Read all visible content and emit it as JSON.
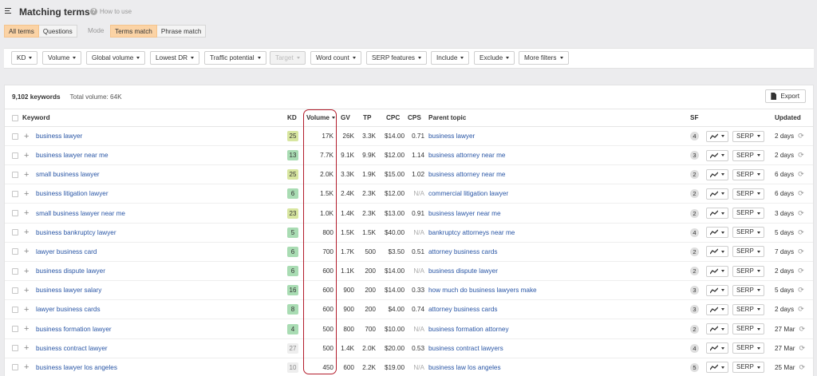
{
  "header": {
    "title": "Matching terms",
    "help_label": "How to use",
    "mode_label": "Mode",
    "scope_tabs": [
      {
        "label": "All terms",
        "active": true
      },
      {
        "label": "Questions",
        "active": false
      }
    ],
    "mode_tabs": [
      {
        "label": "Terms match",
        "active": true
      },
      {
        "label": "Phrase match",
        "active": false
      }
    ]
  },
  "filters": [
    {
      "label": "KD",
      "disabled": false
    },
    {
      "label": "Volume",
      "disabled": false
    },
    {
      "label": "Global volume",
      "disabled": false
    },
    {
      "label": "Lowest DR",
      "disabled": false
    },
    {
      "label": "Traffic potential",
      "disabled": false
    },
    {
      "label": "Target",
      "disabled": true
    },
    {
      "label": "Word count",
      "disabled": false
    },
    {
      "label": "SERP features",
      "disabled": false
    },
    {
      "label": "Include",
      "disabled": false
    },
    {
      "label": "Exclude",
      "disabled": false
    },
    {
      "label": "More filters",
      "disabled": false
    }
  ],
  "summary": {
    "keywords": "9,102 keywords",
    "total_volume": "Total volume: 64K",
    "export_label": "Export"
  },
  "columns": {
    "keyword": "Keyword",
    "kd": "KD",
    "volume": "Volume",
    "gv": "GV",
    "tp": "TP",
    "cpc": "CPC",
    "cps": "CPS",
    "parent_topic": "Parent topic",
    "sf": "SF",
    "updated": "Updated"
  },
  "kd_colors": {
    "low": "#a9dcb3",
    "mid": "#d8e6a0",
    "none": "#eeeeee"
  },
  "rows": [
    {
      "keyword": "business lawyer",
      "kd": "25",
      "kd_level": "mid",
      "volume": "17K",
      "gv": "26K",
      "tp": "3.3K",
      "cpc": "$14.00",
      "cps": "0.71",
      "parent_topic": "business lawyer",
      "sf": "4",
      "serp": "SERP",
      "updated": "2 days"
    },
    {
      "keyword": "business lawyer near me",
      "kd": "13",
      "kd_level": "low",
      "volume": "7.7K",
      "gv": "9.1K",
      "tp": "9.9K",
      "cpc": "$12.00",
      "cps": "1.14",
      "parent_topic": "business attorney near me",
      "sf": "3",
      "serp": "SERP",
      "updated": "2 days"
    },
    {
      "keyword": "small business lawyer",
      "kd": "25",
      "kd_level": "mid",
      "volume": "2.0K",
      "gv": "3.3K",
      "tp": "1.9K",
      "cpc": "$15.00",
      "cps": "1.02",
      "parent_topic": "business attorney near me",
      "sf": "2",
      "serp": "SERP",
      "updated": "6 days"
    },
    {
      "keyword": "business litigation lawyer",
      "kd": "6",
      "kd_level": "low",
      "volume": "1.5K",
      "gv": "2.4K",
      "tp": "2.3K",
      "cpc": "$12.00",
      "cps": "N/A",
      "parent_topic": "commercial litigation lawyer",
      "sf": "2",
      "serp": "SERP",
      "updated": "6 days"
    },
    {
      "keyword": "small business lawyer near me",
      "kd": "23",
      "kd_level": "mid",
      "volume": "1.0K",
      "gv": "1.4K",
      "tp": "2.3K",
      "cpc": "$13.00",
      "cps": "0.91",
      "parent_topic": "business lawyer near me",
      "sf": "2",
      "serp": "SERP",
      "updated": "3 days"
    },
    {
      "keyword": "business bankruptcy lawyer",
      "kd": "5",
      "kd_level": "low",
      "volume": "800",
      "gv": "1.5K",
      "tp": "1.5K",
      "cpc": "$40.00",
      "cps": "N/A",
      "parent_topic": "bankruptcy attorneys near me",
      "sf": "4",
      "serp": "SERP",
      "updated": "5 days"
    },
    {
      "keyword": "lawyer business card",
      "kd": "6",
      "kd_level": "low",
      "volume": "700",
      "gv": "1.7K",
      "tp": "500",
      "cpc": "$3.50",
      "cps": "0.51",
      "parent_topic": "attorney business cards",
      "sf": "2",
      "serp": "SERP",
      "updated": "7 days"
    },
    {
      "keyword": "business dispute lawyer",
      "kd": "6",
      "kd_level": "low",
      "volume": "600",
      "gv": "1.1K",
      "tp": "200",
      "cpc": "$14.00",
      "cps": "N/A",
      "parent_topic": "business dispute lawyer",
      "sf": "2",
      "serp": "SERP",
      "updated": "2 days"
    },
    {
      "keyword": "business lawyer salary",
      "kd": "16",
      "kd_level": "low",
      "volume": "600",
      "gv": "900",
      "tp": "200",
      "cpc": "$14.00",
      "cps": "0.33",
      "parent_topic": "how much do business lawyers make",
      "sf": "3",
      "serp": "SERP",
      "updated": "5 days"
    },
    {
      "keyword": "lawyer business cards",
      "kd": "8",
      "kd_level": "low",
      "volume": "600",
      "gv": "900",
      "tp": "200",
      "cpc": "$4.00",
      "cps": "0.74",
      "parent_topic": "attorney business cards",
      "sf": "3",
      "serp": "SERP",
      "updated": "2 days"
    },
    {
      "keyword": "business formation lawyer",
      "kd": "4",
      "kd_level": "low",
      "volume": "500",
      "gv": "800",
      "tp": "700",
      "cpc": "$10.00",
      "cps": "N/A",
      "parent_topic": "business formation attorney",
      "sf": "2",
      "serp": "SERP",
      "updated": "27 Mar"
    },
    {
      "keyword": "business contract lawyer",
      "kd": "27",
      "kd_level": "none",
      "volume": "500",
      "gv": "1.4K",
      "tp": "2.0K",
      "cpc": "$20.00",
      "cps": "0.53",
      "parent_topic": "business contract lawyers",
      "sf": "4",
      "serp": "SERP",
      "updated": "27 Mar"
    },
    {
      "keyword": "business lawyer los angeles",
      "kd": "10",
      "kd_level": "none",
      "volume": "450",
      "gv": "600",
      "tp": "2.2K",
      "cpc": "$19.00",
      "cps": "N/A",
      "parent_topic": "business law los angeles",
      "sf": "5",
      "serp": "SERP",
      "updated": "25 Mar"
    }
  ]
}
